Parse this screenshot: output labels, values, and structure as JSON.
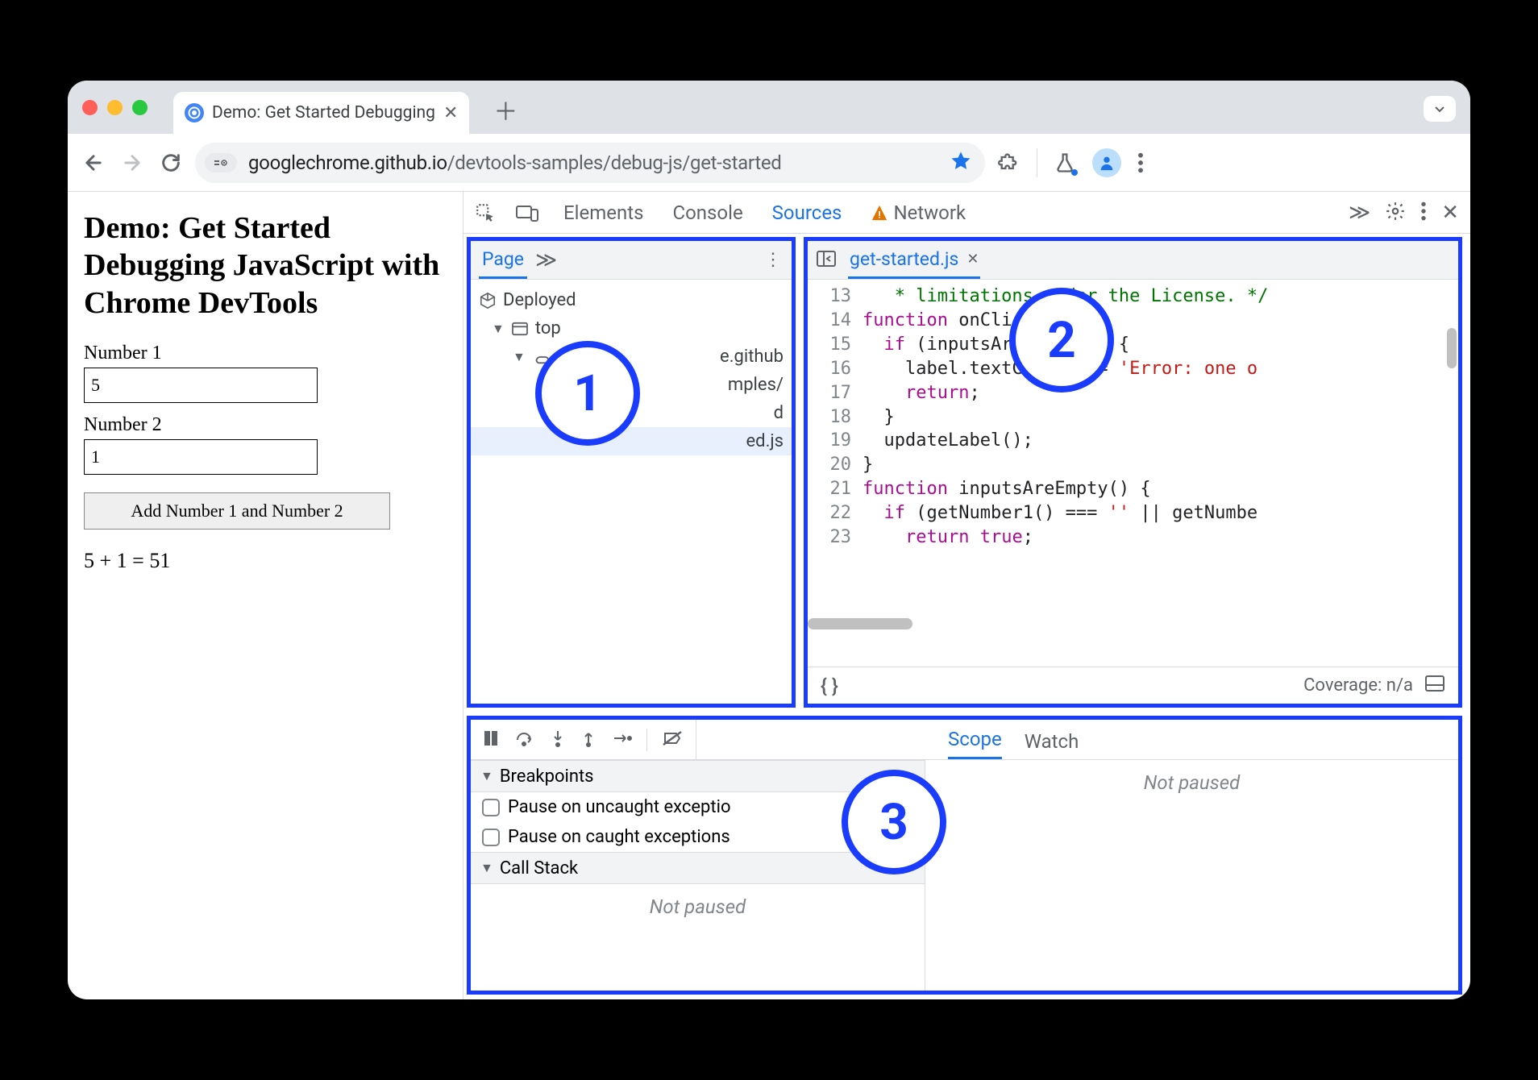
{
  "tab": {
    "title": "Demo: Get Started Debugging"
  },
  "url": {
    "host": "googlechrome.github.io",
    "path": "/devtools-samples/debug-js/get-started"
  },
  "page": {
    "heading": "Demo: Get Started Debugging JavaScript with Chrome DevTools",
    "label1": "Number 1",
    "value1": "5",
    "label2": "Number 2",
    "value2": "1",
    "button": "Add Number 1 and Number 2",
    "result": "5 + 1 = 51"
  },
  "devtools_tabs": {
    "elements": "Elements",
    "console": "Console",
    "sources": "Sources",
    "network": "Network"
  },
  "navigator": {
    "page_tab": "Page",
    "deployed": "Deployed",
    "top": "top",
    "domain": "e.github",
    "folder": "mples/",
    "file_partial": "ed.js"
  },
  "editor": {
    "open_file": "get-started.js",
    "line_start": 13,
    "lines": [
      {
        "n": 13,
        "html": "   * limitations under the License. */"
      },
      {
        "n": 14,
        "html": "function onClick() {"
      },
      {
        "n": 15,
        "html": "  if (inputsAreEmpty()) {"
      },
      {
        "n": 16,
        "html": "    label.textContent = 'Error: one o"
      },
      {
        "n": 17,
        "html": "    return;"
      },
      {
        "n": 18,
        "html": "  }"
      },
      {
        "n": 19,
        "html": "  updateLabel();"
      },
      {
        "n": 20,
        "html": "}"
      },
      {
        "n": 21,
        "html": "function inputsAreEmpty() {"
      },
      {
        "n": 22,
        "html": "  if (getNumber1() === '' || getNumbe"
      },
      {
        "n": 23,
        "html": "    return true;"
      }
    ],
    "coverage": "Coverage: n/a"
  },
  "debugger": {
    "breakpoints_h": "Breakpoints",
    "pause_uncaught": "Pause on uncaught exceptio",
    "pause_caught": "Pause on caught exceptions",
    "callstack_h": "Call Stack",
    "not_paused": "Not paused",
    "scope": "Scope",
    "watch": "Watch"
  },
  "badges": {
    "one": "1",
    "two": "2",
    "three": "3"
  }
}
